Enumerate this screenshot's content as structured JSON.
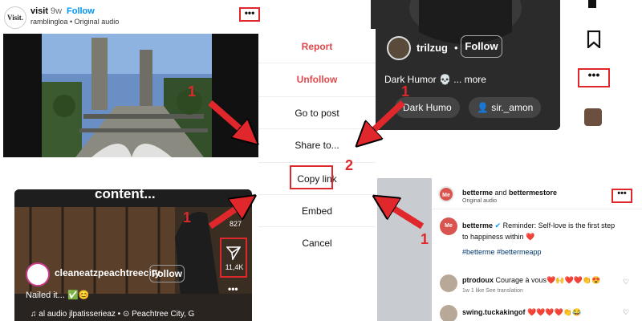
{
  "top_left_post": {
    "logo_text": "Visit.",
    "username": "visit",
    "separator": "•",
    "age": "9w",
    "follow_label": "Follow",
    "audio_line": "ramblingloa • Original audio",
    "more_label": "•••"
  },
  "top_right_reel": {
    "username": "trilzug",
    "separator": "•",
    "follow_label": "Follow",
    "caption": "Dark Humor 💀 ... more",
    "chip_1": "Dark Humo",
    "chip_2": "sir._amon",
    "more_label": "•••"
  },
  "menu": {
    "items": [
      {
        "label": "Report"
      },
      {
        "label": "Unfollow"
      },
      {
        "label": "Go to post"
      },
      {
        "label": "Share to..."
      },
      {
        "label": "Copy link"
      },
      {
        "label": "Embed"
      },
      {
        "label": "Cancel"
      }
    ]
  },
  "step_markers": {
    "tr": "1",
    "copy": "2",
    "tl": "1",
    "bl": "1",
    "br": "1"
  },
  "bottom_left_reel": {
    "overlay_text": "content...",
    "username": "cleaneatzpeachtreecity",
    "follow_label": "Follow",
    "caption": "Nailed it... ✅😊",
    "audio_row": "♫    al audio    jlpatisserieaz   •   ⊙ Peachtree City, G",
    "share_count": "11,4K",
    "side_count": "827",
    "more_label": "•••"
  },
  "bottom_right_post": {
    "account_logo": "Me",
    "names_1": "betterme",
    "names_join": " and ",
    "names_2": "bettermestore",
    "audio": "Original audio",
    "more_label": "•••",
    "caption_user": "betterme",
    "caption_text": " Reminder: Self-love is the first step to happiness within ❤️",
    "tags": "#betterme #bettermeapp",
    "comments": [
      {
        "user": "ptrodoux",
        "text": " Courage à vous❤️🙌❤️❤️👏😍",
        "meta": "1w   1 like   See translation"
      },
      {
        "user": "swing.tuckakingof",
        "text": " ❤️❤️❤️❤️👏😂",
        "meta": ""
      }
    ]
  },
  "colors": {
    "accent_red": "#e0272b",
    "instagram_blue": "#0095f6"
  }
}
